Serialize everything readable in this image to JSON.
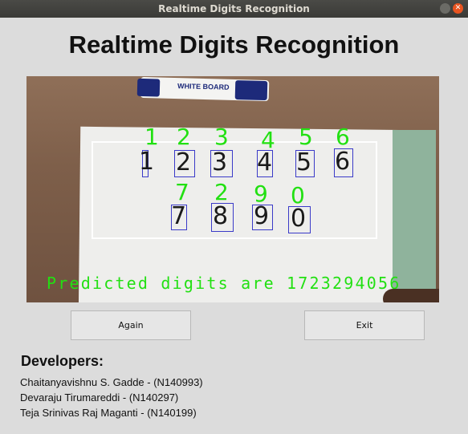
{
  "window": {
    "title": "Realtime Digits Recognition"
  },
  "heading": "Realtime Digits Recognition",
  "camera": {
    "marker_brand": "WHITE BOARD",
    "handwritten_row1": [
      "1",
      "2",
      "3",
      "4",
      "5",
      "6"
    ],
    "handwritten_row2": [
      "7",
      "8",
      "9",
      "0"
    ],
    "predicted_row1": [
      "1",
      "2",
      "3",
      "4",
      "5",
      "6"
    ],
    "predicted_row2": [
      "7",
      "2",
      "9",
      "0"
    ],
    "prediction_text": "Predicted digits are 1723294056",
    "overlay_color": "#22e012",
    "roi_color": "#ffffff",
    "box_color": "#3a3ac8"
  },
  "buttons": {
    "again": "Again",
    "exit": "Exit"
  },
  "developers": {
    "title": "Developers:",
    "names": [
      "Chaitanyavishnu S. Gadde - (N140993)",
      "Devaraju Tirumareddi - (N140297)",
      "Teja Srinivas Raj Maganti - (N140199)"
    ]
  }
}
